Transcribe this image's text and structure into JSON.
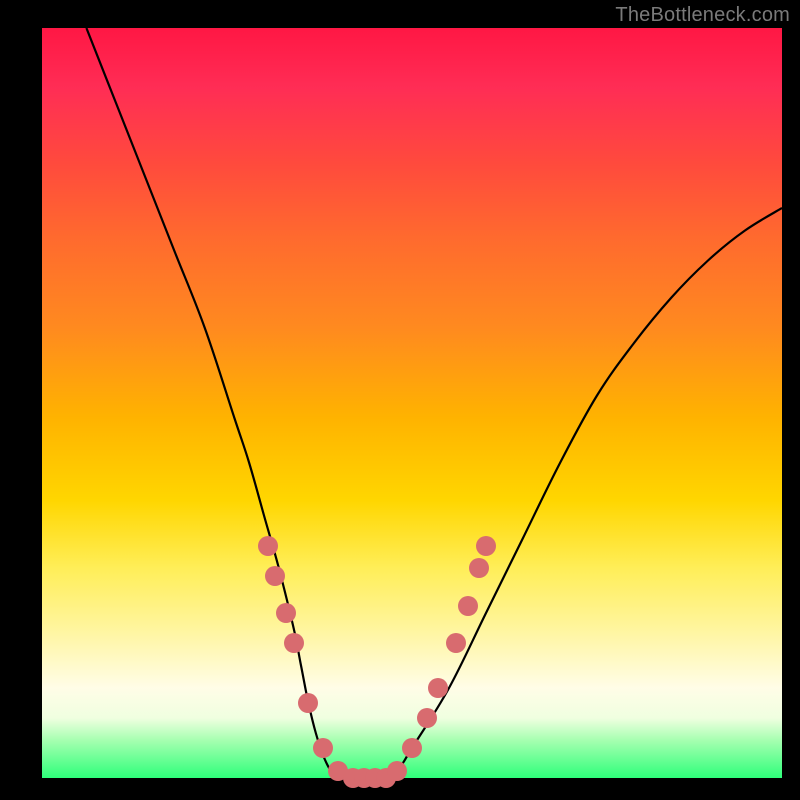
{
  "watermark": "TheBottleneck.com",
  "colors": {
    "marker": "#d86b6f",
    "curve": "#000000",
    "border": "#000000",
    "gradient_stops": [
      "#ff1744",
      "#ff2d55",
      "#ff4a3d",
      "#ff6a2e",
      "#ff8a1f",
      "#ffb300",
      "#ffd600",
      "#ffee58",
      "#fff59d",
      "#fffde7",
      "#f0ffe0",
      "#a5ffb0",
      "#2eff7a"
    ]
  },
  "chart_data": {
    "type": "line",
    "title": "",
    "xlabel": "",
    "ylabel": "",
    "xlim": [
      0,
      100
    ],
    "ylim": [
      0,
      100
    ],
    "grid": false,
    "legend": false,
    "notes": "V-shaped bottleneck curve; axes unlabeled; y visually maps to severity (red high, green low). Background gradient encodes severity, markers cluster near the trough.",
    "series": [
      {
        "name": "bottleneck-curve",
        "x": [
          6,
          10,
          14,
          18,
          22,
          26,
          28,
          30,
          32,
          34,
          35,
          36,
          37,
          38,
          39,
          40,
          42,
          44,
          46,
          48,
          50,
          55,
          60,
          65,
          70,
          75,
          80,
          85,
          90,
          95,
          100
        ],
        "y": [
          100,
          90,
          80,
          70,
          60,
          48,
          42,
          35,
          28,
          20,
          15,
          10,
          6,
          3,
          1,
          0,
          0,
          0,
          0,
          1,
          4,
          12,
          22,
          32,
          42,
          51,
          58,
          64,
          69,
          73,
          76
        ]
      }
    ],
    "markers": [
      {
        "x": 30.5,
        "y": 31
      },
      {
        "x": 31.5,
        "y": 27
      },
      {
        "x": 33.0,
        "y": 22
      },
      {
        "x": 34.0,
        "y": 18
      },
      {
        "x": 36.0,
        "y": 10
      },
      {
        "x": 38.0,
        "y": 4
      },
      {
        "x": 40.0,
        "y": 1
      },
      {
        "x": 42.0,
        "y": 0
      },
      {
        "x": 43.5,
        "y": 0
      },
      {
        "x": 45.0,
        "y": 0
      },
      {
        "x": 46.5,
        "y": 0
      },
      {
        "x": 48.0,
        "y": 1
      },
      {
        "x": 50.0,
        "y": 4
      },
      {
        "x": 52.0,
        "y": 8
      },
      {
        "x": 53.5,
        "y": 12
      },
      {
        "x": 56.0,
        "y": 18
      },
      {
        "x": 57.5,
        "y": 23
      },
      {
        "x": 59.0,
        "y": 28
      },
      {
        "x": 60.0,
        "y": 31
      }
    ]
  }
}
